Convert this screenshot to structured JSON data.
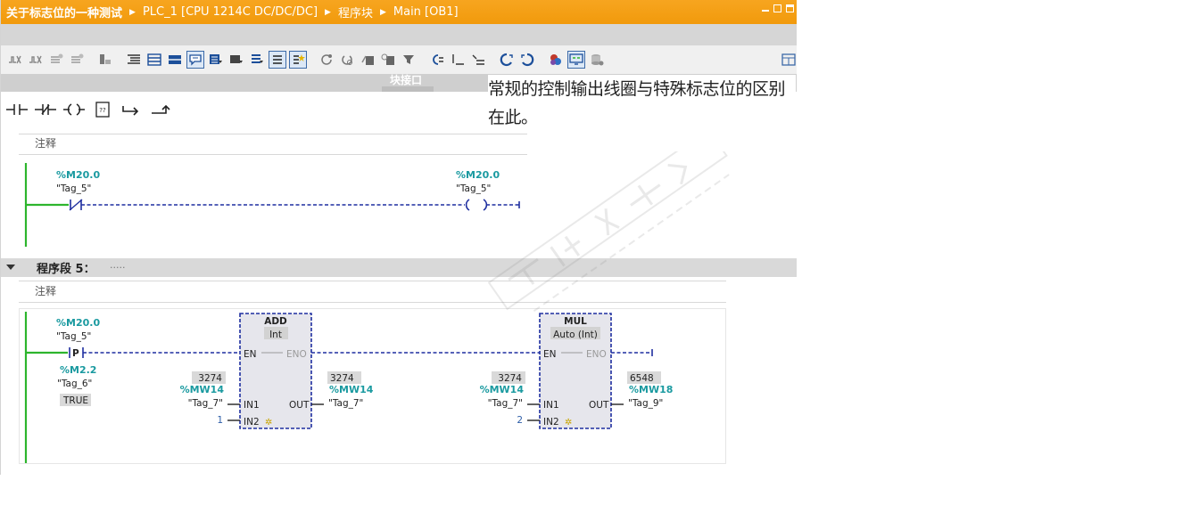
{
  "titlebar": {
    "crumbs": [
      "关于标志位的一种测试",
      "PLC_1 [CPU 1214C DC/DC/DC]",
      "程序块",
      "Main [OB1]"
    ]
  },
  "toolbar": {
    "buttons": [
      "insert-network-icon",
      "delete-network-icon",
      "insert-row-icon",
      "add-row-icon",
      "absolute-address-icon",
      "open-all-networks-icon",
      "close-all-networks-icon",
      "favorites-icon",
      "show-comments-icon",
      "network-comment-icon",
      "tag-info-icon",
      "expand-icon",
      "tag-list-icon",
      "favorites-bar-icon",
      "go-to-next-error-icon",
      "go-to-previous-error-icon",
      "compare-icon",
      "monitor-icon",
      "call-structure-icon",
      "jump-icon",
      "assign-icon",
      "show-all-icon",
      "modify-icon",
      "force-icon",
      "monitoring-on-off-icon",
      "settings-icon",
      "stack-icon"
    ],
    "right_icon": "window-split-icon"
  },
  "block_interface": {
    "label": "块接口"
  },
  "ladder_elements": [
    "normally-open-contact-icon",
    "normally-closed-contact-icon",
    "output-coil-icon",
    "empty-box-icon",
    "open-branch-icon",
    "close-branch-icon"
  ],
  "network4": {
    "comment": "注释",
    "contact": {
      "address": "%M20.0",
      "tag": "\"Tag_5\""
    },
    "coil": {
      "address": "%M20.0",
      "tag": "\"Tag_5\""
    }
  },
  "network5": {
    "title": "程序段 5：",
    "dots": ".....",
    "comment": "注释",
    "p_contact": {
      "address": "%M20.0",
      "tag": "\"Tag_5\"",
      "letter": "P"
    },
    "edge_memory": {
      "address": "%M2.2",
      "tag": "\"Tag_6\"",
      "value": "TRUE"
    },
    "add_block": {
      "name": "ADD",
      "type": "Int",
      "en": "EN",
      "eno": "ENO",
      "in1": "IN1",
      "in2": "IN2",
      "out": "OUT",
      "in1_value": "3274",
      "in1_address": "%MW14",
      "in1_tag": "\"Tag_7\"",
      "in2_const": "1",
      "out_value": "3274",
      "out_address": "%MW14",
      "out_tag": "\"Tag_7\""
    },
    "mul_block": {
      "name": "MUL",
      "type": "Auto (Int)",
      "en": "EN",
      "eno": "ENO",
      "in1": "IN1",
      "in2": "IN2",
      "out": "OUT",
      "in1_value": "3274",
      "in1_address": "%MW14",
      "in1_tag": "\"Tag_7\"",
      "in2_const": "2",
      "out_value": "6548",
      "out_address": "%MW18",
      "out_tag": "\"Tag_9\""
    }
  },
  "annotation": "常规的控制输出线圈与特殊标志位的区别在此。",
  "colors": {
    "title_orange": "#f39c12",
    "power_rail": "#2db52d",
    "wire_dashed": "#1f2fa0",
    "address_teal": "#1a9aa0"
  }
}
